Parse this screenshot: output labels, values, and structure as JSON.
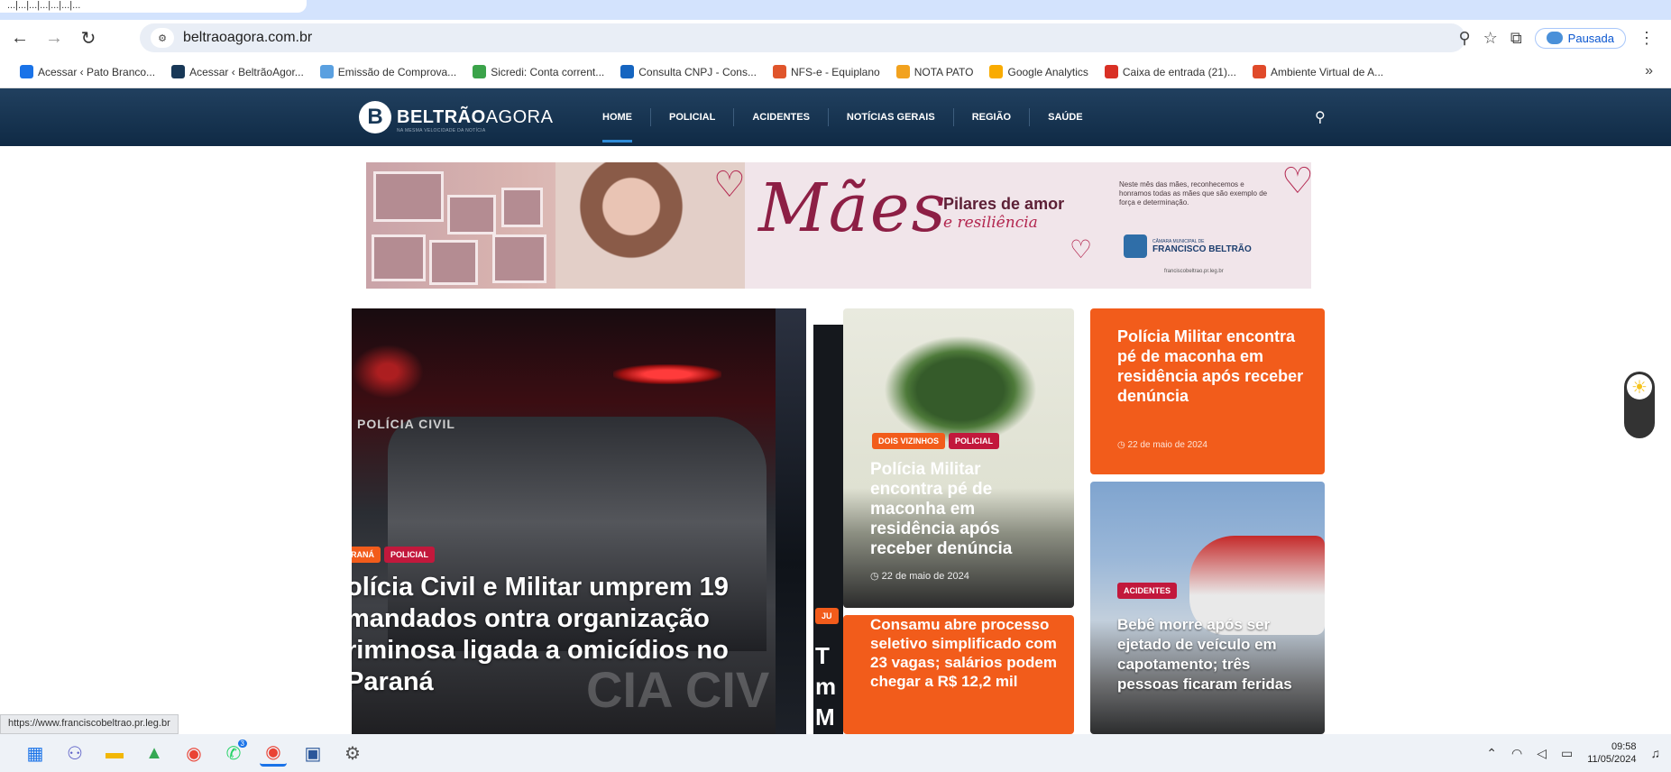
{
  "browser": {
    "tab_fragment": "...|...|...|...|...|...|...",
    "url": "beltraoagora.com.br",
    "profile_status": "Pausada",
    "bookmarks": [
      {
        "label": "Acessar ‹ Pato Branco...",
        "color": "#1a73e8"
      },
      {
        "label": "Acessar ‹ BeltrãoAgor...",
        "color": "#183857"
      },
      {
        "label": "Emissão de Comprova...",
        "color": "#5aa0e0"
      },
      {
        "label": "Sicredi: Conta corrent...",
        "color": "#3ba34a"
      },
      {
        "label": "Consulta CNPJ - Cons...",
        "color": "#1565c0"
      },
      {
        "label": "NFS-e - Equiplano",
        "color": "#e0552b"
      },
      {
        "label": "NOTA PATO",
        "color": "#f2a21e"
      },
      {
        "label": "Google Analytics",
        "color": "#f9ab00"
      },
      {
        "label": "Caixa de entrada (21)...",
        "color": "#d93025"
      },
      {
        "label": "Ambiente Virtual de A...",
        "color": "#e04a2a"
      }
    ],
    "more_label": "»"
  },
  "site": {
    "logo_text_bold": "BELTRÃO",
    "logo_text_light": "AGORA",
    "tagline": "NA MESMA VELOCIDADE DA NOTÍCIA",
    "nav": [
      "HOME",
      "POLICIAL",
      "ACIDENTES",
      "NOTÍCIAS GERAIS",
      "REGIÃO",
      "SAÚDE"
    ]
  },
  "banner": {
    "headline": "Mães",
    "pilares": "Pilares de amor",
    "pilares_sub": "e resiliência",
    "side_text": "Neste mês das mães, reconhecemos e honramos todas as mães que são exemplo de força e determinação.",
    "org_small": "CÂMARA MUNICIPAL DE",
    "org": "FRANCISCO BELTRÃO",
    "org_url": "franciscobeltrao.pr.leg.br"
  },
  "articles": {
    "hero": {
      "tags": [
        "RANÁ",
        "POLICIAL"
      ],
      "title": "olícia Civil e Militar umprem 19 mandados ontra organização riminosa ligada a omicídios no Paraná",
      "vehicle_text": "POLÍCIA CIVIL",
      "bg_text": "CIA CIV"
    },
    "sliver": {
      "tag": "JU",
      "frags": [
        "T",
        "m",
        "M"
      ]
    },
    "plant": {
      "tags": [
        "DOIS VIZINHOS",
        "POLICIAL"
      ],
      "title": "Polícia Militar encontra pé de maconha em residência após receber denúncia",
      "date": "22 de maio de 2024"
    },
    "orange_top": {
      "title": "Polícia Militar encontra pé de maconha em residência após receber denúncia",
      "date": "22 de maio de 2024"
    },
    "orange_bottom": {
      "title": "Consamu abre processo seletivo simplificado com 23 vagas; salários podem chegar a R$ 12,2 mil"
    },
    "heli": {
      "tags": [
        "ACIDENTES"
      ],
      "title": "Bebê morre após ser ejetado de veículo em capotamento; três pessoas ficaram feridas"
    }
  },
  "status_url": "https://www.franciscobeltrao.pr.leg.br",
  "taskbar": {
    "time": "09:58",
    "date": "11/05/2024",
    "whatsapp_badge": "3"
  }
}
